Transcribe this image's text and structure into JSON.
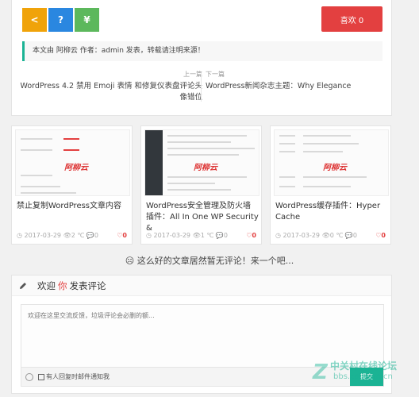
{
  "share": {
    "icons": [
      "share-icon",
      "question-icon",
      "yen-icon"
    ],
    "labels": [
      "<",
      "?",
      "¥"
    ]
  },
  "like": {
    "label": "喜欢 0"
  },
  "copyright": "本文由 阿柳云 作者：admin 发表，转载请注明来源！",
  "prev": {
    "label": "上一篇",
    "title": "WordPress 4.2 禁用 Emoji 表情 和修复仪表盘评论头像错位"
  },
  "next": {
    "label": "下一篇",
    "title": "WordPress新闻杂志主题：Why Elegance"
  },
  "related": [
    {
      "title": "禁止复制WordPress文章内容",
      "date": "2017-03-29",
      "views": "2",
      "comments": "0",
      "likes": "0",
      "logo": "阿柳云"
    },
    {
      "title": "WordPress安全管理及防火墙插件：All In One WP Security &",
      "date": "2017-03-29",
      "views": "1",
      "comments": "0",
      "likes": "0",
      "logo": "阿柳云"
    },
    {
      "title": "WordPress缓存插件：Hyper Cache",
      "date": "2017-03-29",
      "views": "0",
      "comments": "0",
      "likes": "0",
      "logo": "阿柳云"
    }
  ],
  "no_comment": "☹ 这么好的文章居然暂无评论！来一个吧...",
  "comment": {
    "header_pre": "欢迎",
    "header_you": "你",
    "header_post": "发表评论",
    "placeholder": "欢迎在这里交流反馈，垃圾评论会必删的额...",
    "notify_label": "有人回复时邮件通知我",
    "submit": "提交"
  },
  "watermark": {
    "line1": "中关村在线论坛",
    "line2": "bbs.zol.com.cn",
    "mark": "Z"
  },
  "colors": {
    "accent": "#1bb394",
    "like": "#e34040"
  }
}
